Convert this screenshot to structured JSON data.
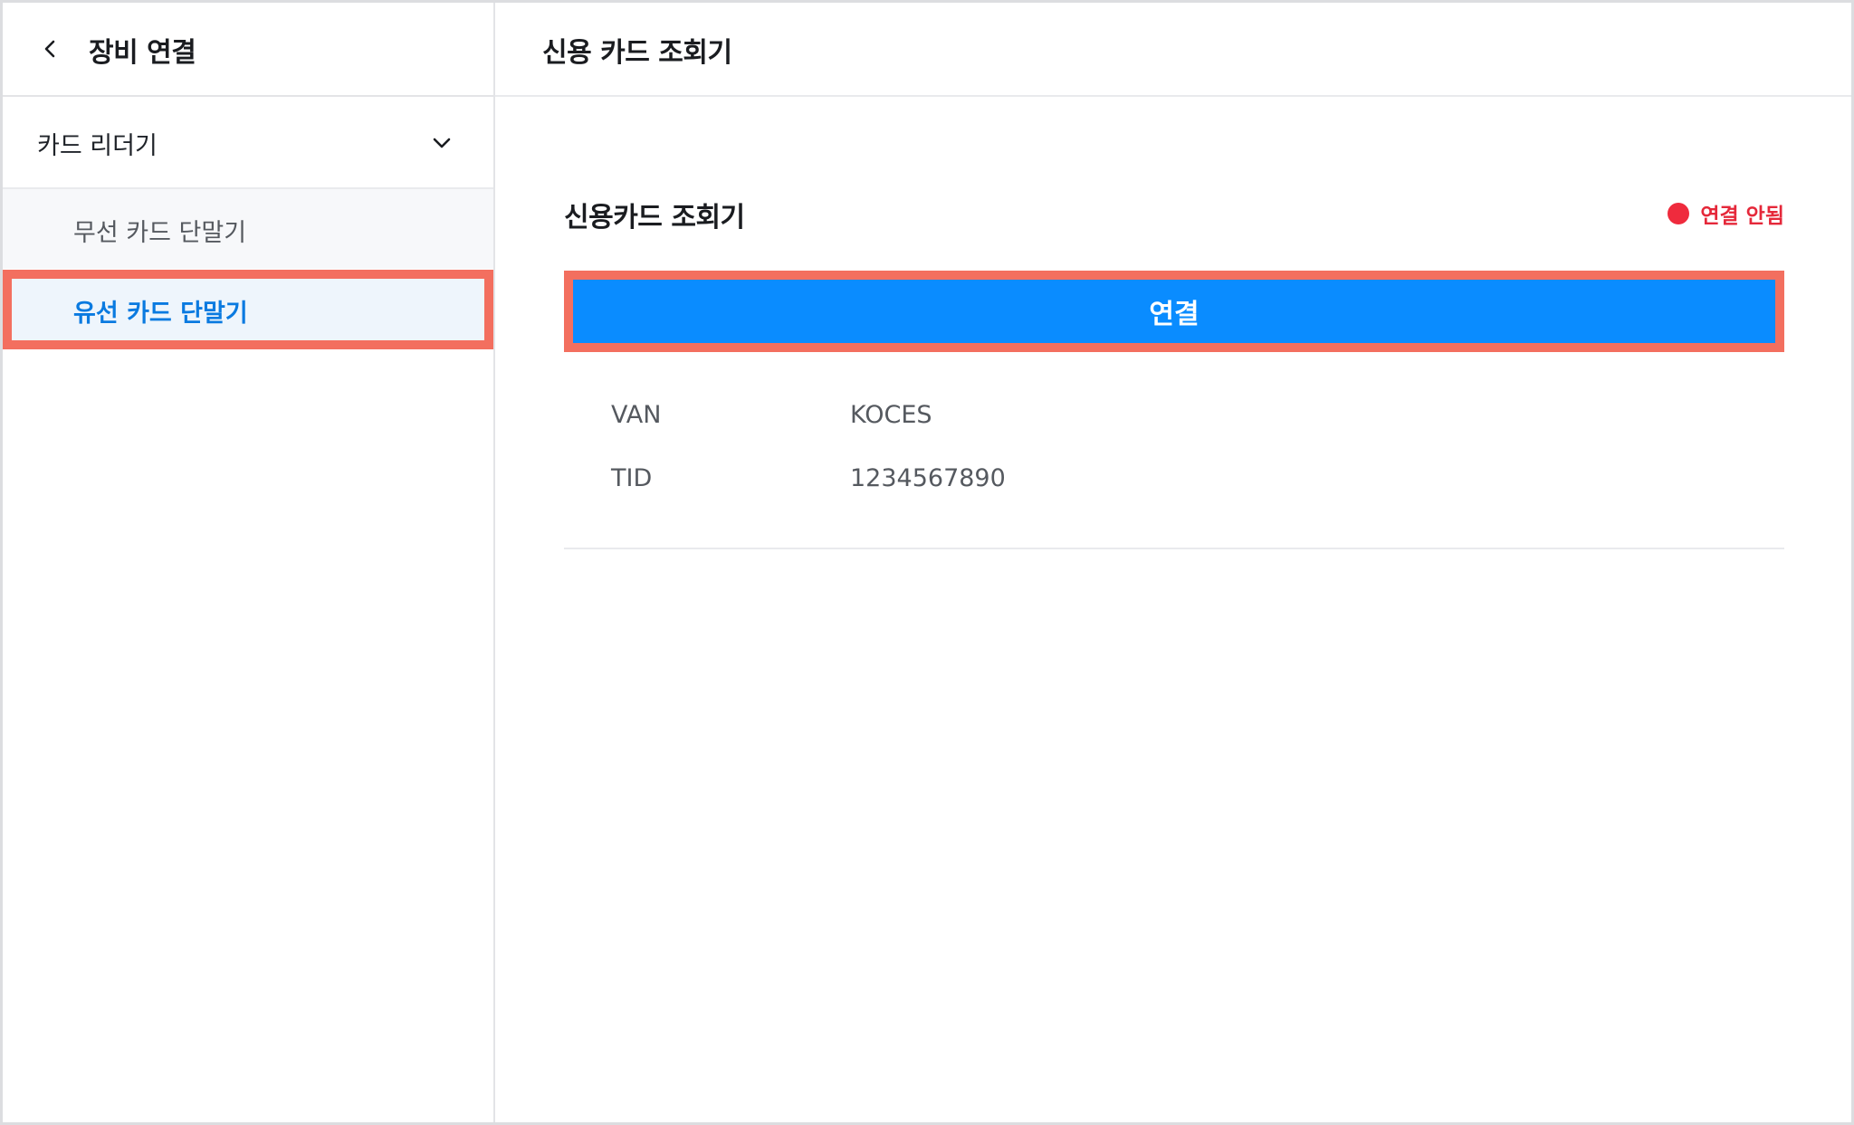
{
  "sidebar": {
    "title": "장비 연결",
    "back_icon": "chevron-left-icon",
    "section": {
      "label": "카드 리더기",
      "icon": "chevron-down-icon",
      "expanded": true
    },
    "items": [
      {
        "label": "무선 카드 단말기",
        "selected": false
      },
      {
        "label": "유선 카드 단말기",
        "selected": true
      }
    ]
  },
  "main": {
    "header_title": "신용 카드 조회기",
    "panel": {
      "title": "신용카드 조회기",
      "status": {
        "label": "연결 안됨",
        "color": "#ef2b3d"
      },
      "connect_button": {
        "label": "연결",
        "color": "#0a8cff"
      },
      "info": [
        {
          "key": "VAN",
          "value": "KOCES"
        },
        {
          "key": "TID",
          "value": "1234567890"
        }
      ]
    }
  },
  "colors": {
    "accent": "#0a8cff",
    "selected_text": "#0a7ae0",
    "highlight_border": "#f36f5f",
    "error": "#ef2b3d"
  }
}
